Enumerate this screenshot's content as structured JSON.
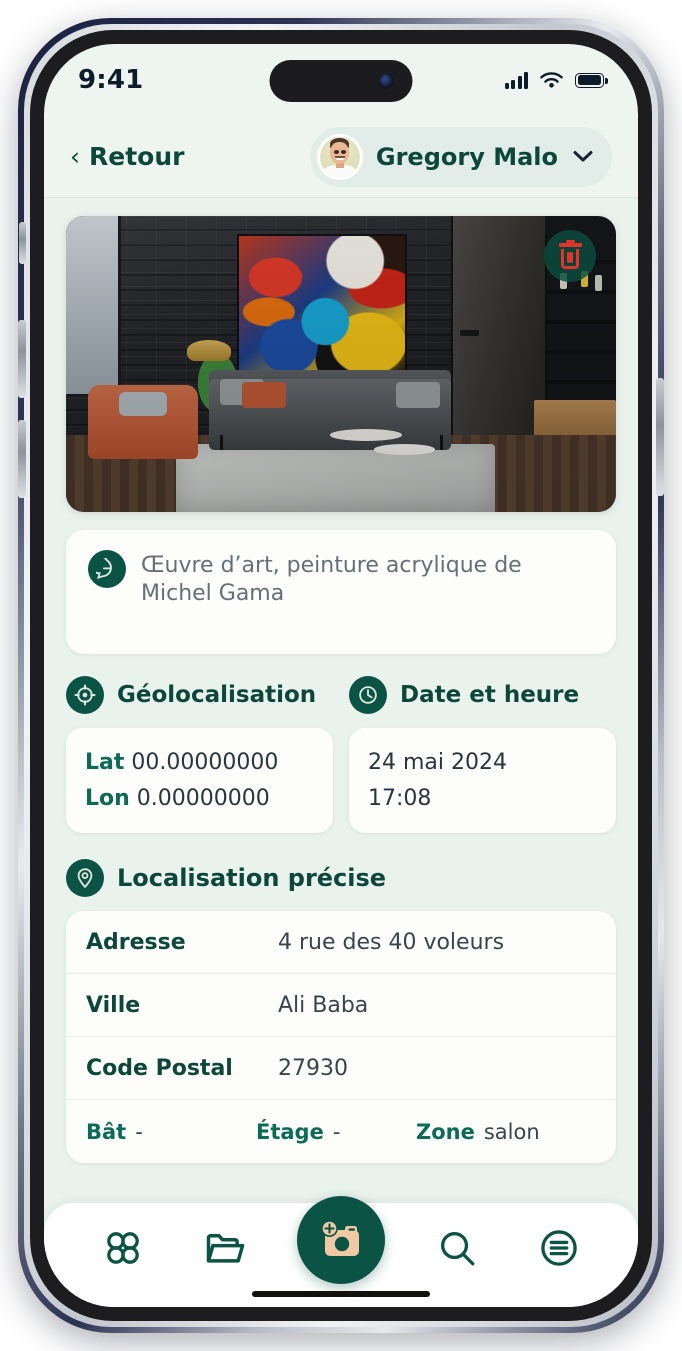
{
  "status_bar": {
    "time": "9:41",
    "signal_icon": "cellular-signal-icon",
    "wifi_icon": "wifi-icon",
    "battery_icon": "battery-icon"
  },
  "header": {
    "back_label": "Retour",
    "back_chevron": "‹",
    "user_name": "Gregory Malo",
    "chevron_down": "⌄"
  },
  "photo": {
    "alt": "Salon loft avec mur de briques noires et peinture abstraite colorée",
    "delete_icon": "trash-icon"
  },
  "description": {
    "icon": "comment-icon",
    "text": "Œuvre d’art, peinture acrylique de Michel Gama"
  },
  "geolocation": {
    "icon": "crosshair-icon",
    "title": "Géolocalisation",
    "lat_label": "Lat",
    "lat_value": "00.00000000",
    "lon_label": "Lon",
    "lon_value": "0.00000000"
  },
  "datetime": {
    "icon": "clock-icon",
    "title": "Date et heure",
    "date": "24 mai 2024",
    "time": "17:08"
  },
  "precise_location": {
    "icon": "map-pin-icon",
    "title": "Localisation précise",
    "rows": [
      {
        "label": "Adresse",
        "value": "4 rue des 40 voleurs"
      },
      {
        "label": "Ville",
        "value": "Ali Baba"
      },
      {
        "label": "Code Postal",
        "value": "27930"
      }
    ],
    "inline": [
      {
        "label": "Bât",
        "value": "-"
      },
      {
        "label": "Étage",
        "value": "-"
      },
      {
        "label": "Zone",
        "value": "salon"
      }
    ]
  },
  "tabbar": {
    "items": [
      {
        "icon": "grid-apps-icon",
        "name": "tab-apps"
      },
      {
        "icon": "folder-icon",
        "name": "tab-folder"
      },
      {
        "icon": "add-photo-camera-icon",
        "name": "tab-capture"
      },
      {
        "icon": "search-icon",
        "name": "tab-search"
      },
      {
        "icon": "menu-list-circle-icon",
        "name": "tab-menu"
      }
    ]
  },
  "colors": {
    "brand_dark_green": "#0b5345",
    "text_green": "#0c4739",
    "accent_green": "#0b6b55",
    "screen_bg": "#eaf2ee",
    "card_bg": "#fdfdfc",
    "delete_red": "#e0342c",
    "camera_beige": "#efc9a4"
  }
}
